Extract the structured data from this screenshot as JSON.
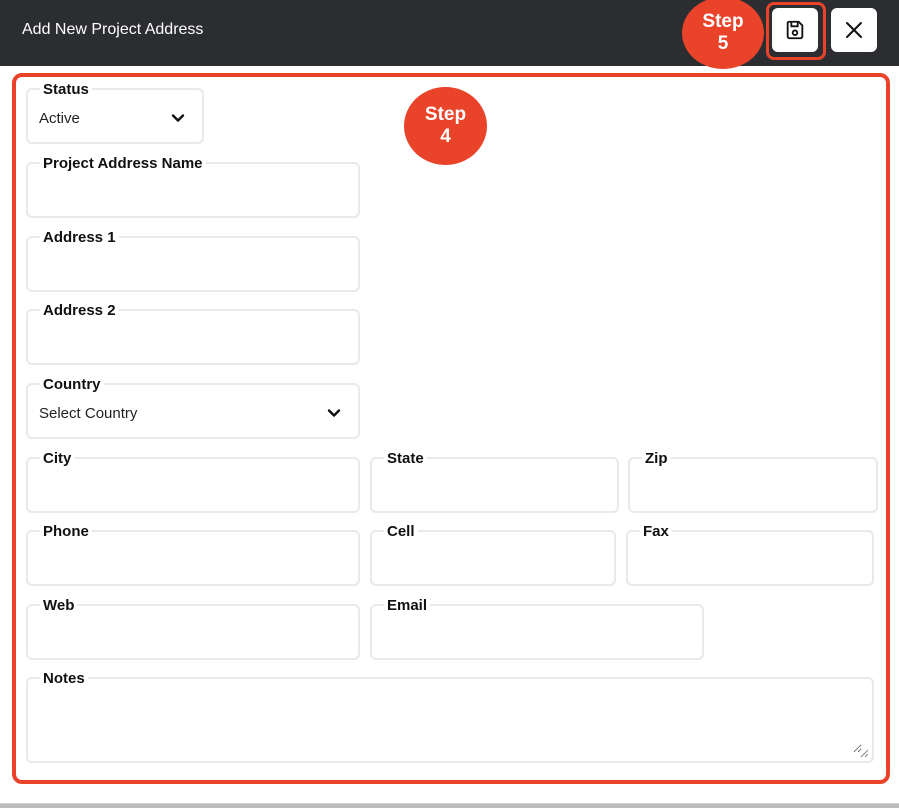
{
  "header": {
    "title": "Add New Project Address"
  },
  "icons": {
    "save": "save-icon",
    "close": "close-icon",
    "chevron": "chevron-down-icon"
  },
  "annotations": {
    "step4": {
      "line1": "Step",
      "line2": "4"
    },
    "step5": {
      "line1": "Step",
      "line2": "5"
    },
    "color": "#e9432a"
  },
  "form": {
    "status": {
      "label": "Status",
      "value": "Active"
    },
    "project_address_name": {
      "label": "Project Address Name",
      "value": ""
    },
    "address1": {
      "label": "Address 1",
      "value": ""
    },
    "address2": {
      "label": "Address 2",
      "value": ""
    },
    "country": {
      "label": "Country",
      "value": "Select Country"
    },
    "city": {
      "label": "City",
      "value": ""
    },
    "state": {
      "label": "State",
      "value": ""
    },
    "zip": {
      "label": "Zip",
      "value": ""
    },
    "phone": {
      "label": "Phone",
      "value": ""
    },
    "cell": {
      "label": "Cell",
      "value": ""
    },
    "fax": {
      "label": "Fax",
      "value": ""
    },
    "web": {
      "label": "Web",
      "value": ""
    },
    "email": {
      "label": "Email",
      "value": ""
    },
    "notes": {
      "label": "Notes",
      "value": ""
    }
  },
  "colors": {
    "header_bg": "#2b2d31",
    "accent": "#e9432a",
    "field_border": "#e9e9e9"
  }
}
